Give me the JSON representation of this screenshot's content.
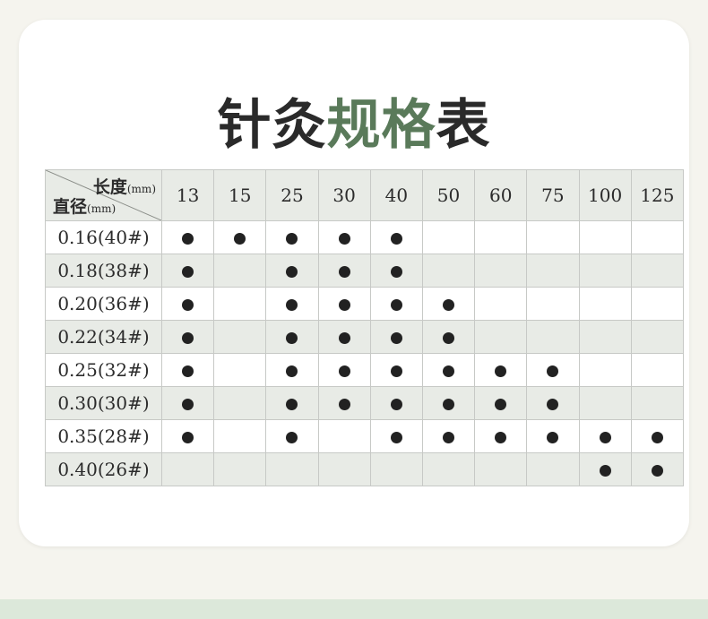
{
  "title": {
    "part1": "针灸",
    "part2": "规格",
    "part3": "表"
  },
  "colors": {
    "accent": "#5a7a5a",
    "header_bg": "#e8ebe6",
    "dot": "#222222"
  },
  "table": {
    "corner": {
      "top_label": "长度",
      "top_unit": "(mm)",
      "bottom_label": "直径",
      "bottom_unit": "(mm)"
    },
    "lengths": [
      "13",
      "15",
      "25",
      "30",
      "40",
      "50",
      "60",
      "75",
      "100",
      "125"
    ],
    "rows": [
      {
        "diameter": "0.16(40#)",
        "available": [
          true,
          true,
          true,
          true,
          true,
          false,
          false,
          false,
          false,
          false
        ]
      },
      {
        "diameter": "0.18(38#)",
        "available": [
          true,
          false,
          true,
          true,
          true,
          false,
          false,
          false,
          false,
          false
        ]
      },
      {
        "diameter": "0.20(36#)",
        "available": [
          true,
          false,
          true,
          true,
          true,
          true,
          false,
          false,
          false,
          false
        ]
      },
      {
        "diameter": "0.22(34#)",
        "available": [
          true,
          false,
          true,
          true,
          true,
          true,
          false,
          false,
          false,
          false
        ]
      },
      {
        "diameter": "0.25(32#)",
        "available": [
          true,
          false,
          true,
          true,
          true,
          true,
          true,
          true,
          false,
          false
        ]
      },
      {
        "diameter": "0.30(30#)",
        "available": [
          true,
          false,
          true,
          true,
          true,
          true,
          true,
          true,
          false,
          false
        ]
      },
      {
        "diameter": "0.35(28#)",
        "available": [
          true,
          false,
          true,
          false,
          true,
          true,
          true,
          true,
          true,
          true
        ]
      },
      {
        "diameter": "0.40(26#)",
        "available": [
          false,
          false,
          false,
          false,
          false,
          false,
          false,
          false,
          true,
          true
        ]
      }
    ]
  }
}
